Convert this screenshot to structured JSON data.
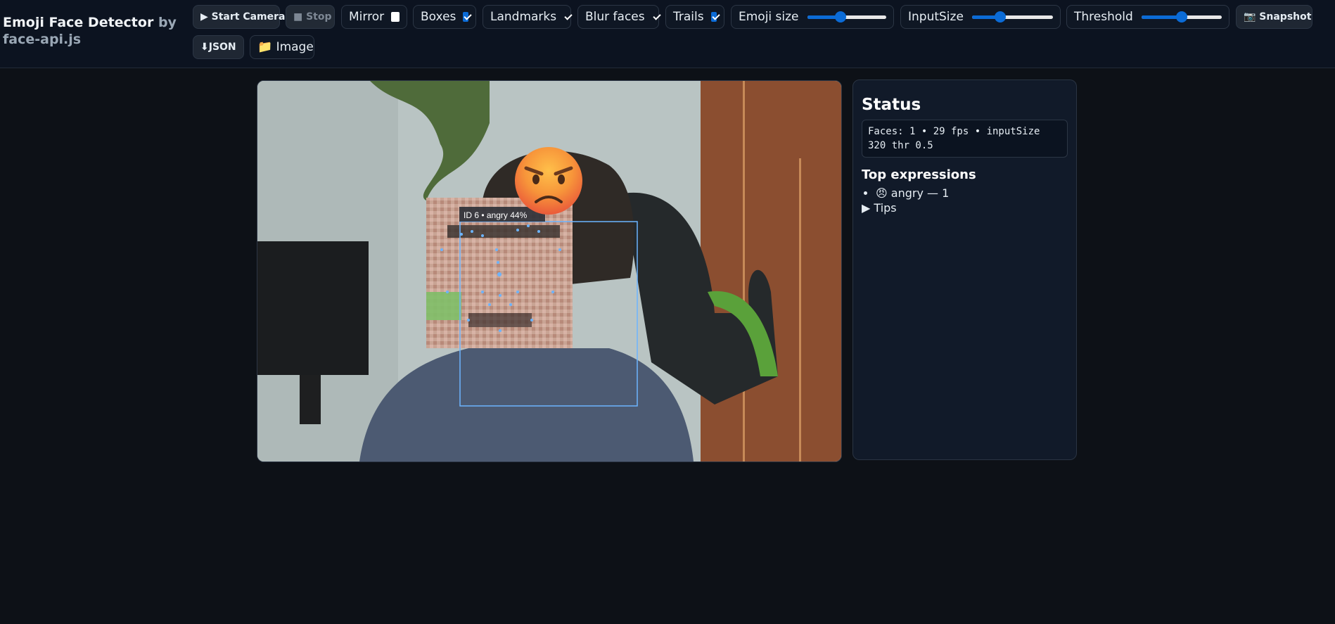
{
  "app": {
    "title": "Emoji Face Detector",
    "subtitle": "by face-api.js"
  },
  "toolbar": {
    "start_label": "▶ Start Camera",
    "stop_label": "■ Stop",
    "mirror_label": "Mirror",
    "mirror_checked": false,
    "boxes_label": "Boxes",
    "boxes_checked": true,
    "landmarks_label": "Landmarks",
    "landmarks_checked": true,
    "blur_label": "Blur faces",
    "blur_checked": true,
    "trails_label": "Trails",
    "trails_checked": true,
    "emoji_size_label": "Emoji size",
    "emoji_size_value": 0.42,
    "input_size_label": "InputSize",
    "input_size_value": 0.35,
    "threshold_label": "Threshold",
    "threshold_value": 0.5,
    "snapshot_label": "📷 Snapshot",
    "json_label": "⬇JSON",
    "image_label": "📁 Image"
  },
  "video": {
    "face_label": "ID 6 • angry 44%",
    "emoji": "😠"
  },
  "status": {
    "heading": "Status",
    "text": "Faces: 1 • 29 fps • inputSize 320 thr 0.5",
    "expressions_heading": "Top expressions",
    "expressions": [
      {
        "emoji": "😠",
        "text": "angry — 1"
      }
    ],
    "tips_label": "Tips"
  },
  "colors": {
    "accent": "#0b6bd6",
    "box": "#6cb4ff",
    "background": "#0d1117"
  }
}
